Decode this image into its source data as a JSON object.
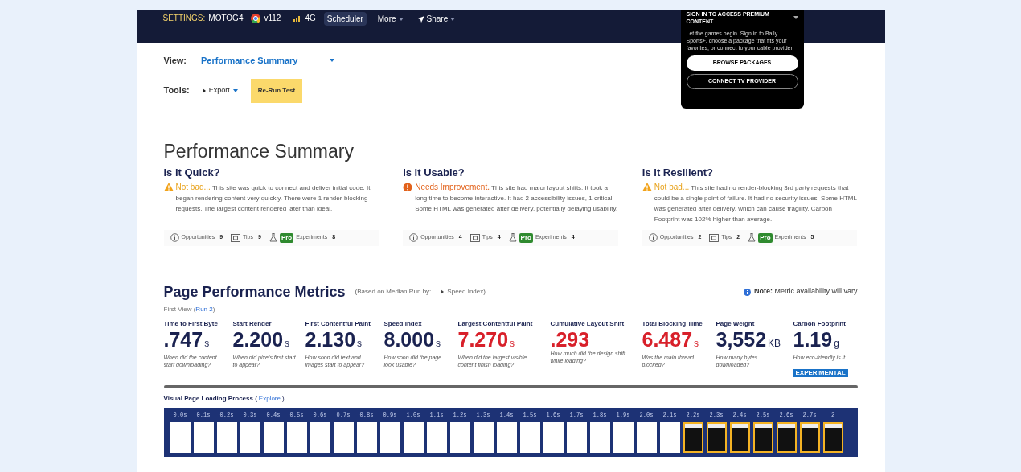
{
  "header": {
    "settings_label": "SETTINGS:",
    "device": "MOTOG4",
    "browser": "v112",
    "connection": "4G",
    "buttons": [
      "Scheduler",
      "More",
      "Share"
    ]
  },
  "popup": {
    "title": "SIGN IN TO ACCESS PREMIUM CONTENT",
    "text": "Let the games begin. Sign in to Bally Sports+, choose a package that fits your favorites, or connect to your cable provider.",
    "buttons": [
      "BROWSE PACKAGES",
      "CONNECT TV PROVIDER"
    ]
  },
  "view": {
    "label": "View:",
    "value": "Performance Summary"
  },
  "tools": {
    "label": "Tools:",
    "export": "Export",
    "rerun": "Re-Run Test"
  },
  "summary": {
    "title": "Performance Summary",
    "cards": [
      {
        "title": "Is it Quick?",
        "kind": "warning",
        "verdict": "Not bad...",
        "text": "This site was quick to connect and deliver initial code. It began rendering content very quickly. There were 1 render-blocking requests. The largest content rendered later than ideal.",
        "stats": [
          {
            "kind": "opportunities",
            "label": "Opportunities",
            "count": "9"
          },
          {
            "kind": "tips",
            "label": "Tips",
            "count": "9"
          },
          {
            "kind": "experiments",
            "badge": "Pro",
            "label": "Experiments",
            "count": "8"
          }
        ]
      },
      {
        "title": "Is it Usable?",
        "kind": "error",
        "verdict": "Needs Improvement.",
        "text": "This site had major layout shifts. It took a long time to become interactive. It had 2 accessibility issues, 1 critical. Some HTML was generated after delivery, potentially delaying usability.",
        "stats": [
          {
            "kind": "opportunities",
            "label": "Opportunities",
            "count": "4"
          },
          {
            "kind": "tips",
            "label": "Tips",
            "count": "4"
          },
          {
            "kind": "experiments",
            "badge": "Pro",
            "label": "Experiments",
            "count": "4"
          }
        ]
      },
      {
        "title": "Is it Resilient?",
        "kind": "warning",
        "verdict": "Not bad...",
        "text": "This site had no render-blocking 3rd party requests that could be a single point of failure. It had no security issues. Some HTML was generated after delivery, which can cause fragility. Carbon Footprint was 102% higher than average.",
        "stats": [
          {
            "kind": "opportunities",
            "label": "Opportunities",
            "count": "2"
          },
          {
            "kind": "tips",
            "label": "Tips",
            "count": "2"
          },
          {
            "kind": "experiments",
            "badge": "Pro",
            "label": "Experiments",
            "count": "5"
          }
        ]
      }
    ]
  },
  "metrics": {
    "title": "Page Performance Metrics",
    "basis": "(Based on Median Run by:",
    "basis_metric": "Speed Index)",
    "note_label": "Note:",
    "note": "Metric availability will vary",
    "first_view": "First View (",
    "run_link": "Run 2",
    "first_view_end": ")",
    "items": [
      {
        "label": "Time to First Byte",
        "value": ".747",
        "unit": "s",
        "color": "#1a2250",
        "desc": "When did the content start downloading?"
      },
      {
        "label": "Start Render",
        "value": "2.200",
        "unit": "s",
        "color": "#1a2250",
        "desc": "When did pixels first start to appear?"
      },
      {
        "label": "First Contentful Paint",
        "value": "2.130",
        "unit": "s",
        "color": "#1a2250",
        "desc": "How soon did text and images start to appear?"
      },
      {
        "label": "Speed Index",
        "value": "8.000",
        "unit": "s",
        "color": "#1a2250",
        "desc": "How soon did the page look usable?"
      },
      {
        "label": "Largest Contentful Paint",
        "value": "7.270",
        "unit": "s",
        "color": "#d8202a",
        "desc": "When did the largest visible content finish loading?"
      },
      {
        "label": "Cumulative Layout Shift",
        "value": ".293",
        "color": "#d8202a",
        "desc": "How much did the design shift while loading?"
      },
      {
        "label": "Total Blocking Time",
        "value": "6.487",
        "unit": "s",
        "color": "#d8202a",
        "desc": "Was the main thread blocked?"
      },
      {
        "label": "Page Weight",
        "value": "3,552",
        "unit": "KB",
        "color": "#1a2250",
        "desc": "How many bytes downloaded?"
      },
      {
        "label": "Carbon Footprint",
        "value": "1.19",
        "unit": "g",
        "color": "#1a2250",
        "desc": "How eco-friendly is it",
        "badge": "EXPERIMENTAL"
      }
    ]
  },
  "filmstrip": {
    "title": "Visual Page Loading Process (",
    "link": "Explore",
    "title_end": ")",
    "frames": [
      {
        "time": "0.0s",
        "changed": false
      },
      {
        "time": "0.1s",
        "changed": false
      },
      {
        "time": "0.2s",
        "changed": false
      },
      {
        "time": "0.3s",
        "changed": false
      },
      {
        "time": "0.4s",
        "changed": false
      },
      {
        "time": "0.5s",
        "changed": false
      },
      {
        "time": "0.6s",
        "changed": false
      },
      {
        "time": "0.7s",
        "changed": false
      },
      {
        "time": "0.8s",
        "changed": false
      },
      {
        "time": "0.9s",
        "changed": false
      },
      {
        "time": "1.0s",
        "changed": false
      },
      {
        "time": "1.1s",
        "changed": false
      },
      {
        "time": "1.2s",
        "changed": false
      },
      {
        "time": "1.3s",
        "changed": false
      },
      {
        "time": "1.4s",
        "changed": false
      },
      {
        "time": "1.5s",
        "changed": false
      },
      {
        "time": "1.6s",
        "changed": false
      },
      {
        "time": "1.7s",
        "changed": false
      },
      {
        "time": "1.8s",
        "changed": false
      },
      {
        "time": "1.9s",
        "changed": false
      },
      {
        "time": "2.0s",
        "changed": false
      },
      {
        "time": "2.1s",
        "changed": false
      },
      {
        "time": "2.2s",
        "changed": true
      },
      {
        "time": "2.3s",
        "changed": true
      },
      {
        "time": "2.4s",
        "changed": true
      },
      {
        "time": "2.5s",
        "changed": true
      },
      {
        "time": "2.6s",
        "changed": true
      },
      {
        "time": "2.7s",
        "changed": true
      },
      {
        "time": "2",
        "changed": true
      }
    ]
  }
}
